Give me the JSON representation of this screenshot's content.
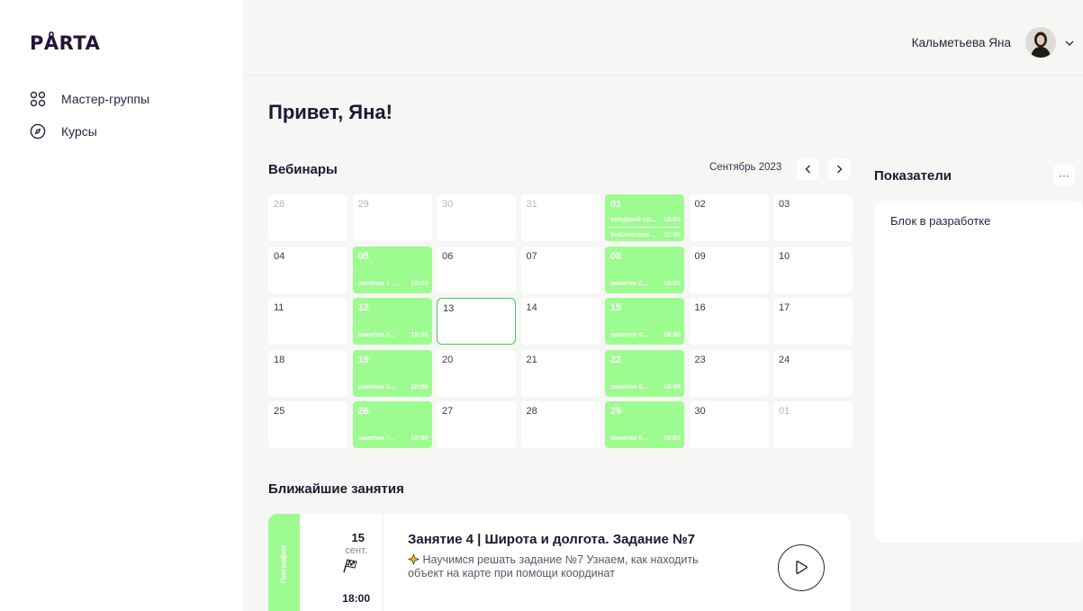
{
  "sidebar": {
    "logo": "PÅRTA",
    "items": [
      {
        "label": "Мастер-группы",
        "icon": "groups-icon"
      },
      {
        "label": "Курсы",
        "icon": "compass-icon"
      }
    ]
  },
  "header": {
    "user_name": "Кальметьева Яна"
  },
  "greeting": "Привет, Яна!",
  "webinars": {
    "title": "Вебинары",
    "month": "Сентябрь 2023",
    "days": [
      {
        "d": "28",
        "muted": true
      },
      {
        "d": "29",
        "muted": true
      },
      {
        "d": "30",
        "muted": true
      },
      {
        "d": "31",
        "muted": true
      },
      {
        "d": "01",
        "events": [
          {
            "name": "вводный ор...",
            "time": "10:00"
          },
          {
            "name": "библиотека ...",
            "time": "11:00"
          }
        ]
      },
      {
        "d": "02"
      },
      {
        "d": "03"
      },
      {
        "d": "04"
      },
      {
        "d": "05",
        "events": [
          {
            "name": "занятие 1 ...",
            "time": "18:00"
          }
        ]
      },
      {
        "d": "06"
      },
      {
        "d": "07"
      },
      {
        "d": "08",
        "events": [
          {
            "name": "занятие 2...",
            "time": "18:00"
          }
        ]
      },
      {
        "d": "09"
      },
      {
        "d": "10"
      },
      {
        "d": "11"
      },
      {
        "d": "12",
        "events": [
          {
            "name": "занятие 3...",
            "time": "18:00"
          }
        ]
      },
      {
        "d": "13",
        "today": true
      },
      {
        "d": "14"
      },
      {
        "d": "15",
        "events": [
          {
            "name": "занятие 4...",
            "time": "18:00"
          }
        ]
      },
      {
        "d": "16"
      },
      {
        "d": "17"
      },
      {
        "d": "18"
      },
      {
        "d": "19",
        "events": [
          {
            "name": "занятие 5...",
            "time": "18:00"
          }
        ]
      },
      {
        "d": "20"
      },
      {
        "d": "21"
      },
      {
        "d": "22",
        "events": [
          {
            "name": "занятие 6...",
            "time": "18:00"
          }
        ]
      },
      {
        "d": "23"
      },
      {
        "d": "24"
      },
      {
        "d": "25"
      },
      {
        "d": "26",
        "events": [
          {
            "name": "занятие 7...",
            "time": "18:00"
          }
        ]
      },
      {
        "d": "27"
      },
      {
        "d": "28"
      },
      {
        "d": "29",
        "events": [
          {
            "name": "занятие 8...",
            "time": "18:00"
          }
        ]
      },
      {
        "d": "30"
      },
      {
        "d": "01",
        "muted": true
      }
    ]
  },
  "indicators": {
    "title": "Показатели",
    "menu": "···",
    "placeholder": "Блок в разработке"
  },
  "upcoming": {
    "title": "Ближайшие занятия",
    "lesson": {
      "subject": "География",
      "day": "15",
      "month": "сент.",
      "time": "18:00",
      "title": "Занятие 4 | Широта и долгота. Задание №7",
      "desc": "Научимся решать задание №7  Узнаем, как находить объект на карте при помощи координат"
    }
  },
  "colors": {
    "accent_green": "#9dfc8f",
    "today_border": "#4cc65c",
    "text_dark": "#1c1830",
    "page_bg": "#f6f6f4"
  }
}
